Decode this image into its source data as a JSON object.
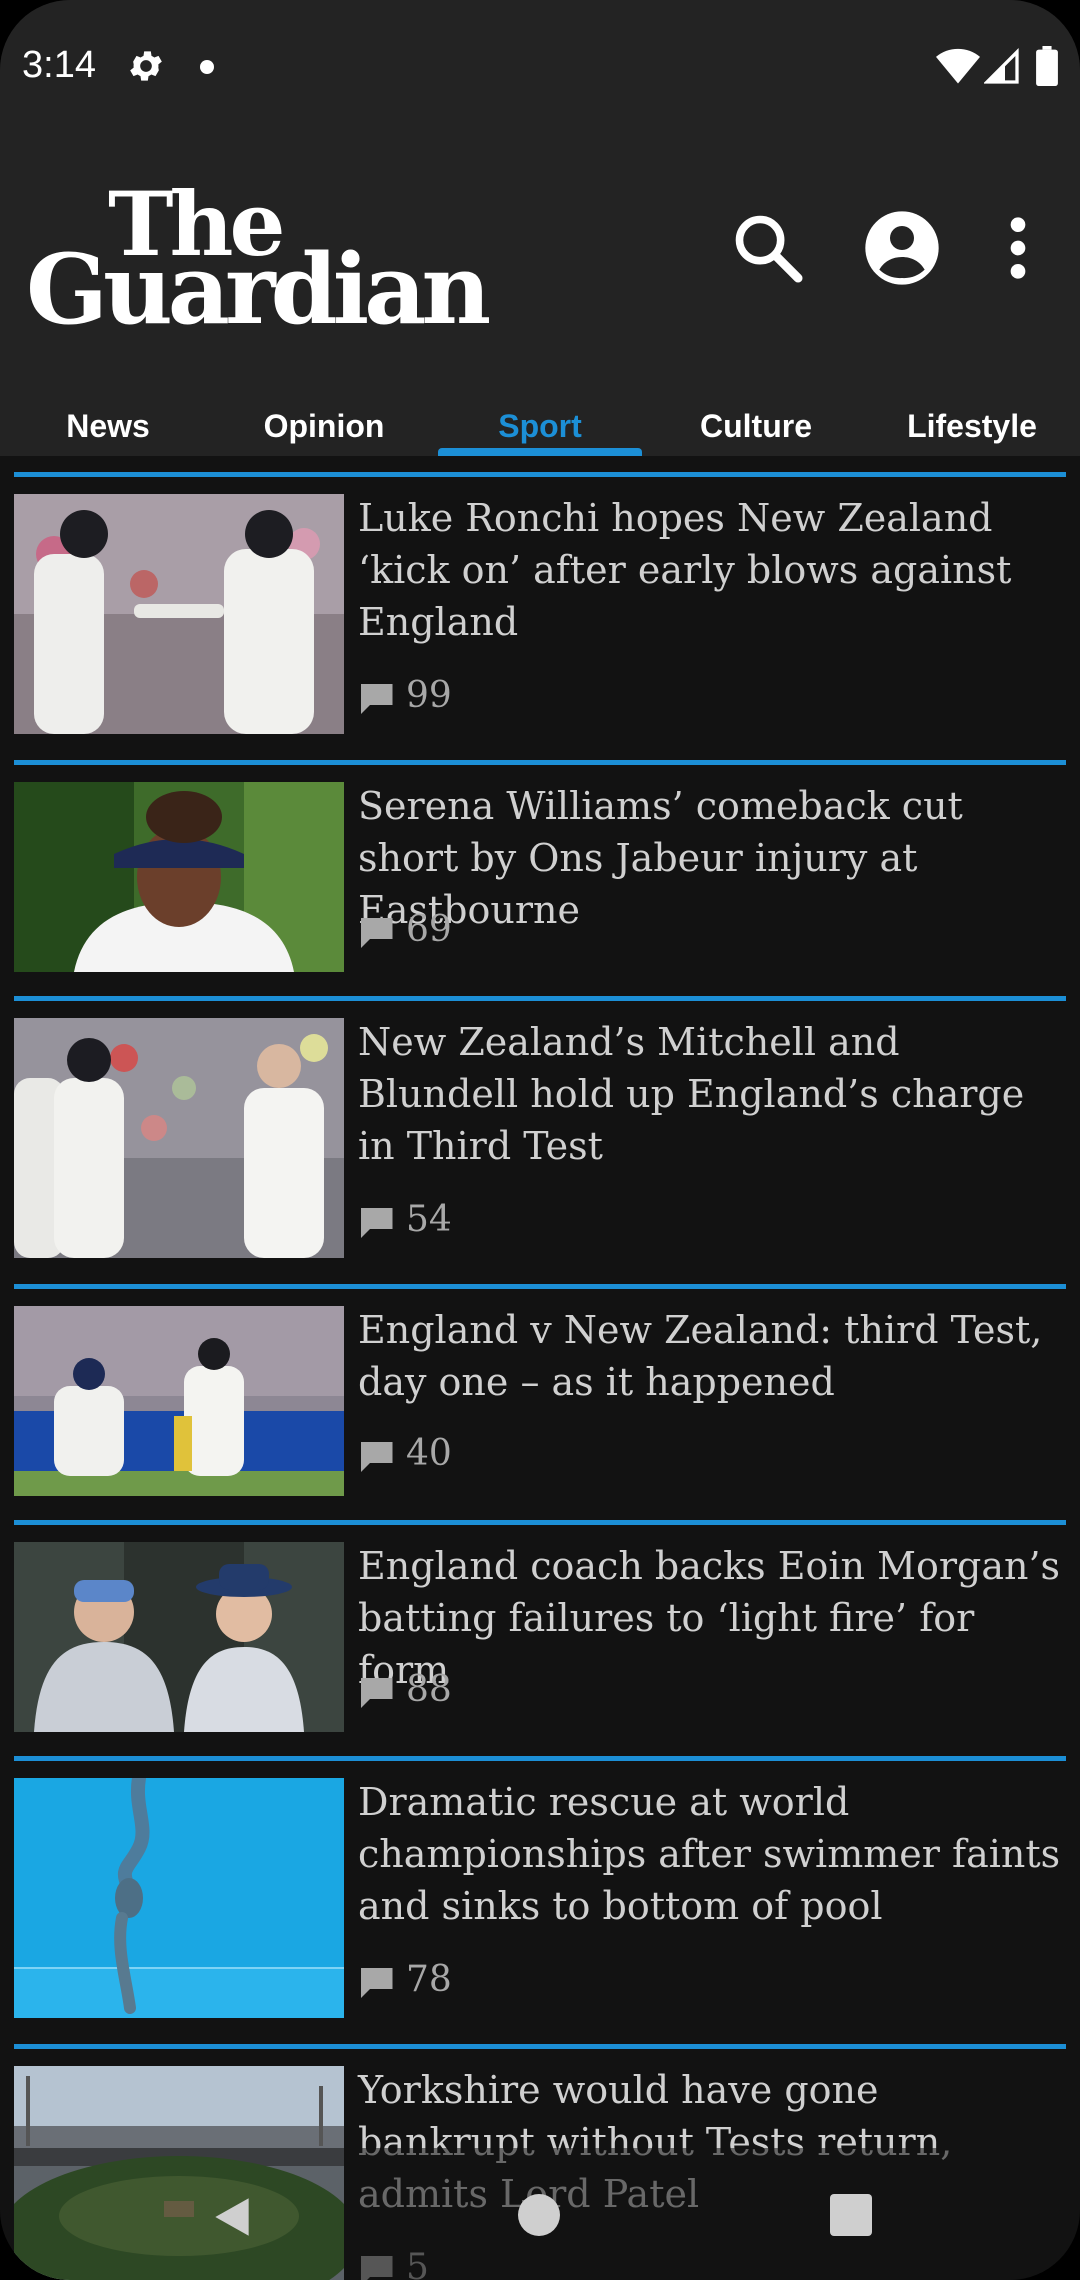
{
  "status_bar": {
    "time": "3:14",
    "icons": [
      "gear-icon",
      "notification-dot",
      "wifi-icon",
      "cell-signal-icon",
      "battery-icon"
    ]
  },
  "header": {
    "logo_line1": "The",
    "logo_line2": "Guardian",
    "icons": [
      "search-icon",
      "account-icon",
      "more-vert-icon"
    ]
  },
  "tabs": [
    {
      "label": "News",
      "active": false
    },
    {
      "label": "Opinion",
      "active": false
    },
    {
      "label": "Sport",
      "active": true
    },
    {
      "label": "Culture",
      "active": false
    },
    {
      "label": "Lifestyle",
      "active": false
    }
  ],
  "colors": {
    "accent": "#1c8fd6",
    "header_bg": "#232323",
    "feed_bg": "#121212"
  },
  "articles": [
    {
      "headline": "Luke Ronchi hopes New Zealand ‘kick on’ after early blows against England",
      "comments": "99",
      "image": "cricket players touching gloves"
    },
    {
      "headline": "Serena Williams’ comeback cut short by Ons Jabeur injury at Eastbourne",
      "comments": "69",
      "image": "tennis player in visor"
    },
    {
      "headline": "New Zealand’s Mitchell and Blundell hold up England’s charge in Third Test",
      "comments": "54",
      "image": "cricket players on field"
    },
    {
      "headline": "England v New Zealand: third Test, day one – as it happened",
      "comments": "40",
      "image": "batter and wicketkeeper"
    },
    {
      "headline": "England coach backs Eoin Morgan’s batting failures to ‘light fire’ for form",
      "comments": "88",
      "image": "two cricket coaches"
    },
    {
      "headline": "Dramatic rescue at world championships after swimmer faints and sinks to bottom of pool",
      "comments": "78",
      "image": "swimmer underwater"
    },
    {
      "headline": "Yorkshire would have gone bankrupt without Tests return, admits Lord Patel",
      "comments": "5",
      "image": "cricket stadium aerial"
    }
  ],
  "nav_bar": {
    "icons": [
      "back-icon",
      "home-icon",
      "recents-icon"
    ]
  }
}
